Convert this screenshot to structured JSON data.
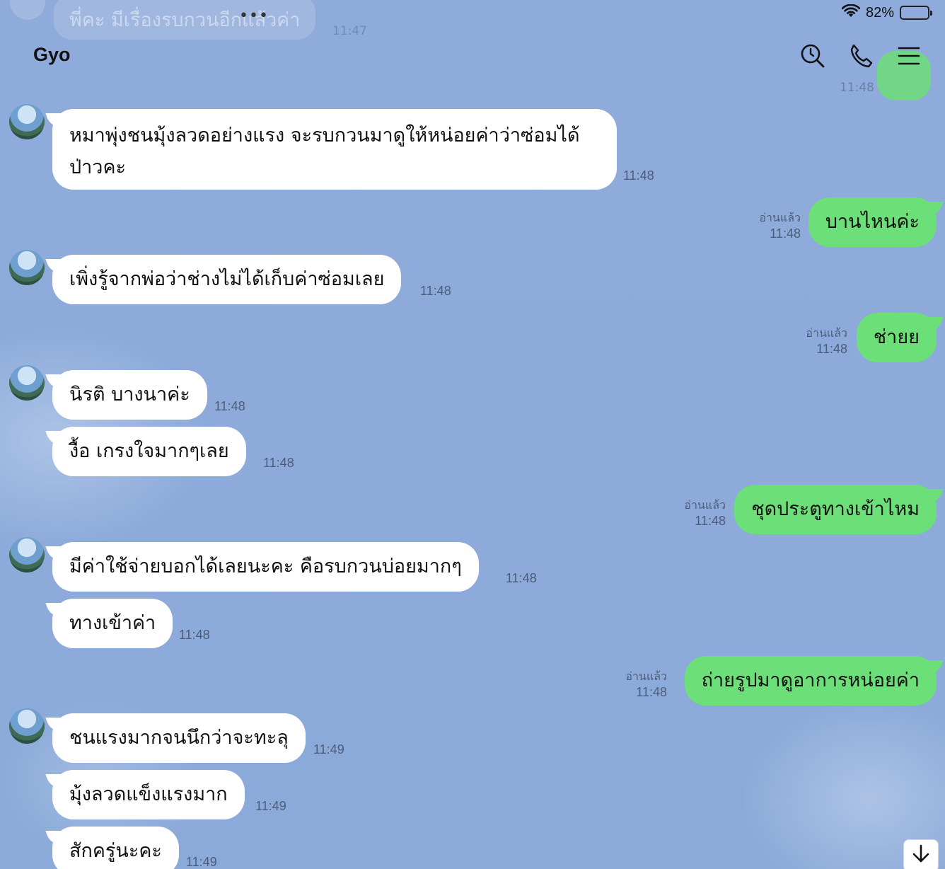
{
  "status_bar": {
    "battery": "82%",
    "battery_level": 0.82
  },
  "ghost_message": {
    "text": "พี่คะ มีเรื่องรบกวนอีกแล้วค่า",
    "time": "11:47"
  },
  "ghost_reply": {
    "time": "11:48"
  },
  "header": {
    "title": "Gyo",
    "icons": [
      "search-icon",
      "phone-icon",
      "menu-icon"
    ],
    "more_dots": "•••"
  },
  "messages": [
    {
      "side": "in",
      "text": "หมาพุ่งชนมุ้งลวดอย่างแรง จะรบกวนมาดูให้หน่อยค่าว่าซ่อมได้ป่าวคะ",
      "time": "11:48"
    },
    {
      "side": "out",
      "text": "บานไหนค่ะ",
      "read": "อ่านแล้ว",
      "time": "11:48"
    },
    {
      "side": "in",
      "text": "เพิ่งรู้จากพ่อว่าช่างไม่ได้เก็บค่าซ่อมเลย",
      "time": "11:48"
    },
    {
      "side": "out",
      "text": "ช่ายย",
      "read": "อ่านแล้ว",
      "time": "11:48"
    },
    {
      "side": "in",
      "text": "นิรติ บางนาค่ะ",
      "time": "11:48"
    },
    {
      "side": "in",
      "text": "งื้อ เกรงใจมากๆเลย",
      "time": "11:48"
    },
    {
      "side": "out",
      "text": "ชุดประตูทางเข้าไหม",
      "read": "อ่านแล้ว",
      "time": "11:48"
    },
    {
      "side": "in",
      "text": "มีค่าใช้จ่ายบอกได้เลยนะคะ คือรบกวนบ่อยมากๆ",
      "time": "11:48"
    },
    {
      "side": "in",
      "text": "ทางเข้าค่า",
      "time": "11:48"
    },
    {
      "side": "out",
      "text": "ถ่ายรูปมาดูอาการหน่อยค่า",
      "read": "อ่านแล้ว",
      "time": "11:48"
    },
    {
      "side": "in",
      "text": "ชนแรงมากจนนึกว่าจะทะลุ",
      "time": "11:49"
    },
    {
      "side": "in",
      "text": "มุ้งลวดแข็งแรงมาก",
      "time": "11:49"
    },
    {
      "side": "in",
      "text": "สักครู่นะคะ",
      "time": "11:49"
    }
  ],
  "colors": {
    "background": "#8eabdb",
    "incoming": "#ffffff",
    "outgoing": "#6ddf78"
  }
}
